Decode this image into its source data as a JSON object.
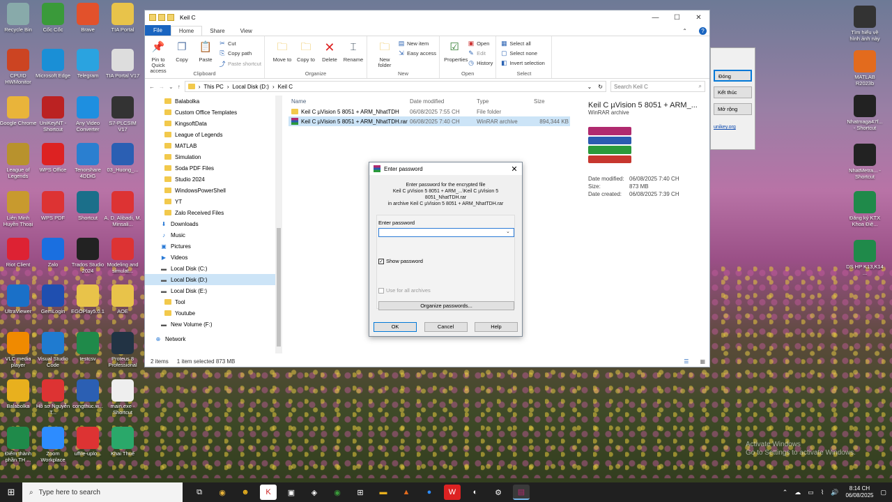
{
  "desktop": {
    "icons": [
      {
        "label": "Recycle Bin",
        "color": "#8aa"
      },
      {
        "label": "Cốc Cốc",
        "color": "#3a9a3a"
      },
      {
        "label": "Brave",
        "color": "#e2512b"
      },
      {
        "label": "TIA Portal",
        "color": "#e8c34a"
      },
      {
        "label": "CPUID HWMonitor",
        "color": "#c42"
      },
      {
        "label": "Microsoft Edge",
        "color": "#1a8fd6"
      },
      {
        "label": "Telegram",
        "color": "#2aa3e0"
      },
      {
        "label": "TIA Portal V17",
        "color": "#ddd"
      },
      {
        "label": "Google Chrome",
        "color": "#e9b43a"
      },
      {
        "label": "UniKeyNT - Shortcut",
        "color": "#b22"
      },
      {
        "label": "Any Video Converter",
        "color": "#1e8fe0"
      },
      {
        "label": "S7-PLCSIM V17",
        "color": "#333"
      },
      {
        "label": "League of Legends",
        "color": "#b8922d"
      },
      {
        "label": "WPS Office",
        "color": "#d22"
      },
      {
        "label": "Tenorshare 4DDiG",
        "color": "#2a7fd0"
      },
      {
        "label": "03_Huong_...",
        "color": "#2b5fb3"
      },
      {
        "label": "Liên Minh Huyền Thoại",
        "color": "#c89a2e"
      },
      {
        "label": "WPS PDF",
        "color": "#d33"
      },
      {
        "label": "Shortcut",
        "color": "#1b6f8a"
      },
      {
        "label": "A. D. Alibadi, M. Minsali...",
        "color": "#d33"
      },
      {
        "label": "Riot Client",
        "color": "#d23"
      },
      {
        "label": "Zalo",
        "color": "#1a6fe0"
      },
      {
        "label": "Trados Studio 2024",
        "color": "#222"
      },
      {
        "label": "Modeling and simulat...",
        "color": "#d33"
      },
      {
        "label": "UltraViewer",
        "color": "#1a70c8"
      },
      {
        "label": "GemLogin",
        "color": "#1f4fb0"
      },
      {
        "label": "EGOPlay5.0.1",
        "color": "#e8c34a"
      },
      {
        "label": "AOE",
        "color": "#e8c34a"
      },
      {
        "label": "VLC media player",
        "color": "#f08a00"
      },
      {
        "label": "Visual Studio Code",
        "color": "#1f7bd0"
      },
      {
        "label": "testcsv",
        "color": "#1f8a4a"
      },
      {
        "label": "Proteus 8 Professional",
        "color": "#234"
      },
      {
        "label": "Balabolka",
        "color": "#e8b01e"
      },
      {
        "label": "Hồ sơ Nguyễn T...",
        "color": "#d33"
      },
      {
        "label": "congthuc.w...",
        "color": "#2b5fb3"
      },
      {
        "label": "main.exe - Shortcut",
        "color": "#eee"
      },
      {
        "label": "Điểm thành phần TH ...",
        "color": "#1f8a4a"
      },
      {
        "label": "Zoom Workplace",
        "color": "#2d8cff"
      },
      {
        "label": "uffile-uplo...",
        "color": "#d33"
      },
      {
        "label": "Khai Thuế",
        "color": "#2aa86a"
      },
      {
        "label": "Tìm hiểu về hình ảnh này",
        "color": "#333"
      },
      {
        "label": "MATLAB R2023b",
        "color": "#e36b1d"
      },
      {
        "label": "Nhatmaga47f... - Shortcut",
        "color": "#222"
      },
      {
        "label": "NhatMetra... - Shortcut",
        "color": "#222"
      },
      {
        "label": "Đăng ký KTX Khoa Điệ...",
        "color": "#1f8a4a"
      },
      {
        "label": "DS HP K13,K14 ...",
        "color": "#1f8a4a"
      }
    ]
  },
  "explorer": {
    "title": "Keil C",
    "tabs": [
      "File",
      "Home",
      "Share",
      "View"
    ],
    "ribbon": {
      "clipboard": {
        "label": "Clipboard",
        "pin": "Pin to Quick access",
        "copy": "Copy",
        "paste": "Paste",
        "cut": "Cut",
        "copy_path": "Copy path",
        "paste_shortcut": "Paste shortcut"
      },
      "organize": {
        "label": "Organize",
        "move_to": "Move to",
        "copy_to": "Copy to",
        "delete": "Delete",
        "rename": "Rename"
      },
      "new": {
        "label": "New",
        "new_folder": "New folder",
        "new_item": "New item",
        "easy_access": "Easy access"
      },
      "open": {
        "label": "Open",
        "properties": "Properties",
        "open": "Open",
        "edit": "Edit",
        "history": "History"
      },
      "select": {
        "label": "Select",
        "select_all": "Select all",
        "select_none": "Select none",
        "invert": "Invert selection"
      }
    },
    "breadcrumb": [
      "This PC",
      "Local Disk (D:)",
      "Keil C"
    ],
    "search_placeholder": "Search Keil C",
    "nav_items": [
      {
        "label": "Balabolka",
        "kind": "folder"
      },
      {
        "label": "Custom Office Templates",
        "kind": "folder"
      },
      {
        "label": "KingsoftData",
        "kind": "folder"
      },
      {
        "label": "League of Legends",
        "kind": "folder"
      },
      {
        "label": "MATLAB",
        "kind": "folder"
      },
      {
        "label": "Simulation",
        "kind": "folder"
      },
      {
        "label": "Soda PDF Files",
        "kind": "folder"
      },
      {
        "label": "Studio 2024",
        "kind": "folder"
      },
      {
        "label": "WindowsPowerShell",
        "kind": "folder"
      },
      {
        "label": "YT",
        "kind": "folder"
      },
      {
        "label": "Zalo Received Files",
        "kind": "folder"
      },
      {
        "label": "Downloads",
        "kind": "down"
      },
      {
        "label": "Music",
        "kind": "music"
      },
      {
        "label": "Pictures",
        "kind": "pic"
      },
      {
        "label": "Videos",
        "kind": "video"
      },
      {
        "label": "Local Disk (C:)",
        "kind": "drive"
      },
      {
        "label": "Local Disk (D:)",
        "kind": "drive",
        "selected": true
      },
      {
        "label": "Local Disk (E:)",
        "kind": "drive"
      },
      {
        "label": "Tool",
        "kind": "folder"
      },
      {
        "label": "Youtube",
        "kind": "folder"
      },
      {
        "label": "New Volume (F:)",
        "kind": "drive"
      },
      {
        "label": "Network",
        "kind": "net"
      }
    ],
    "columns": [
      "Name",
      "Date modified",
      "Type",
      "Size"
    ],
    "files": [
      {
        "name": "Keil C µVision 5 8051 + ARM_NhatTDH",
        "date": "06/08/2025 7:55 CH",
        "type": "File folder",
        "size": "",
        "selected": false
      },
      {
        "name": "Keil C µVision 5 8051 + ARM_NhatTDH.rar",
        "date": "06/08/2025 7:40 CH",
        "type": "WinRAR archive",
        "size": "894,344 KB",
        "selected": true
      }
    ],
    "preview": {
      "title": "Keil C µVision 5 8051 + ARM_...",
      "subtitle": "WinRAR archive",
      "date_modified_label": "Date modified:",
      "date_modified": "06/08/2025 7:40 CH",
      "size_label": "Size:",
      "size": "873 MB",
      "date_created_label": "Date created:",
      "date_created": "06/08/2025 7:39 CH"
    },
    "status": {
      "items": "2 items",
      "selected": "1 item selected  873 MB"
    }
  },
  "dialog": {
    "title": "Enter password",
    "msg1": "Enter password for the encrypted file",
    "msg2": "Keil C µVision 5 8051 + ARM_...\\Keil C µVision 5 8051_NhatTDH.rar",
    "msg3": "in archive Keil C µVision 5 8051 + ARM_NhatTDH.rar",
    "field_label": "Enter password",
    "password_value": "",
    "show_password": "Show password",
    "use_all": "Use for all archives",
    "organize": "Organize passwords...",
    "ok": "OK",
    "cancel": "Cancel",
    "help": "Help"
  },
  "bgwindow": {
    "btn1": "Đóng",
    "btn2": "Kết thúc",
    "btn3": "Mở rộng",
    "link": "unikey.org"
  },
  "taskbar": {
    "search_placeholder": "Type here to search",
    "time": "8:14 CH",
    "date": "06/08/2025"
  },
  "watermark": {
    "line1": "Activate Windows",
    "line2": "Go to Settings to activate Windows."
  }
}
